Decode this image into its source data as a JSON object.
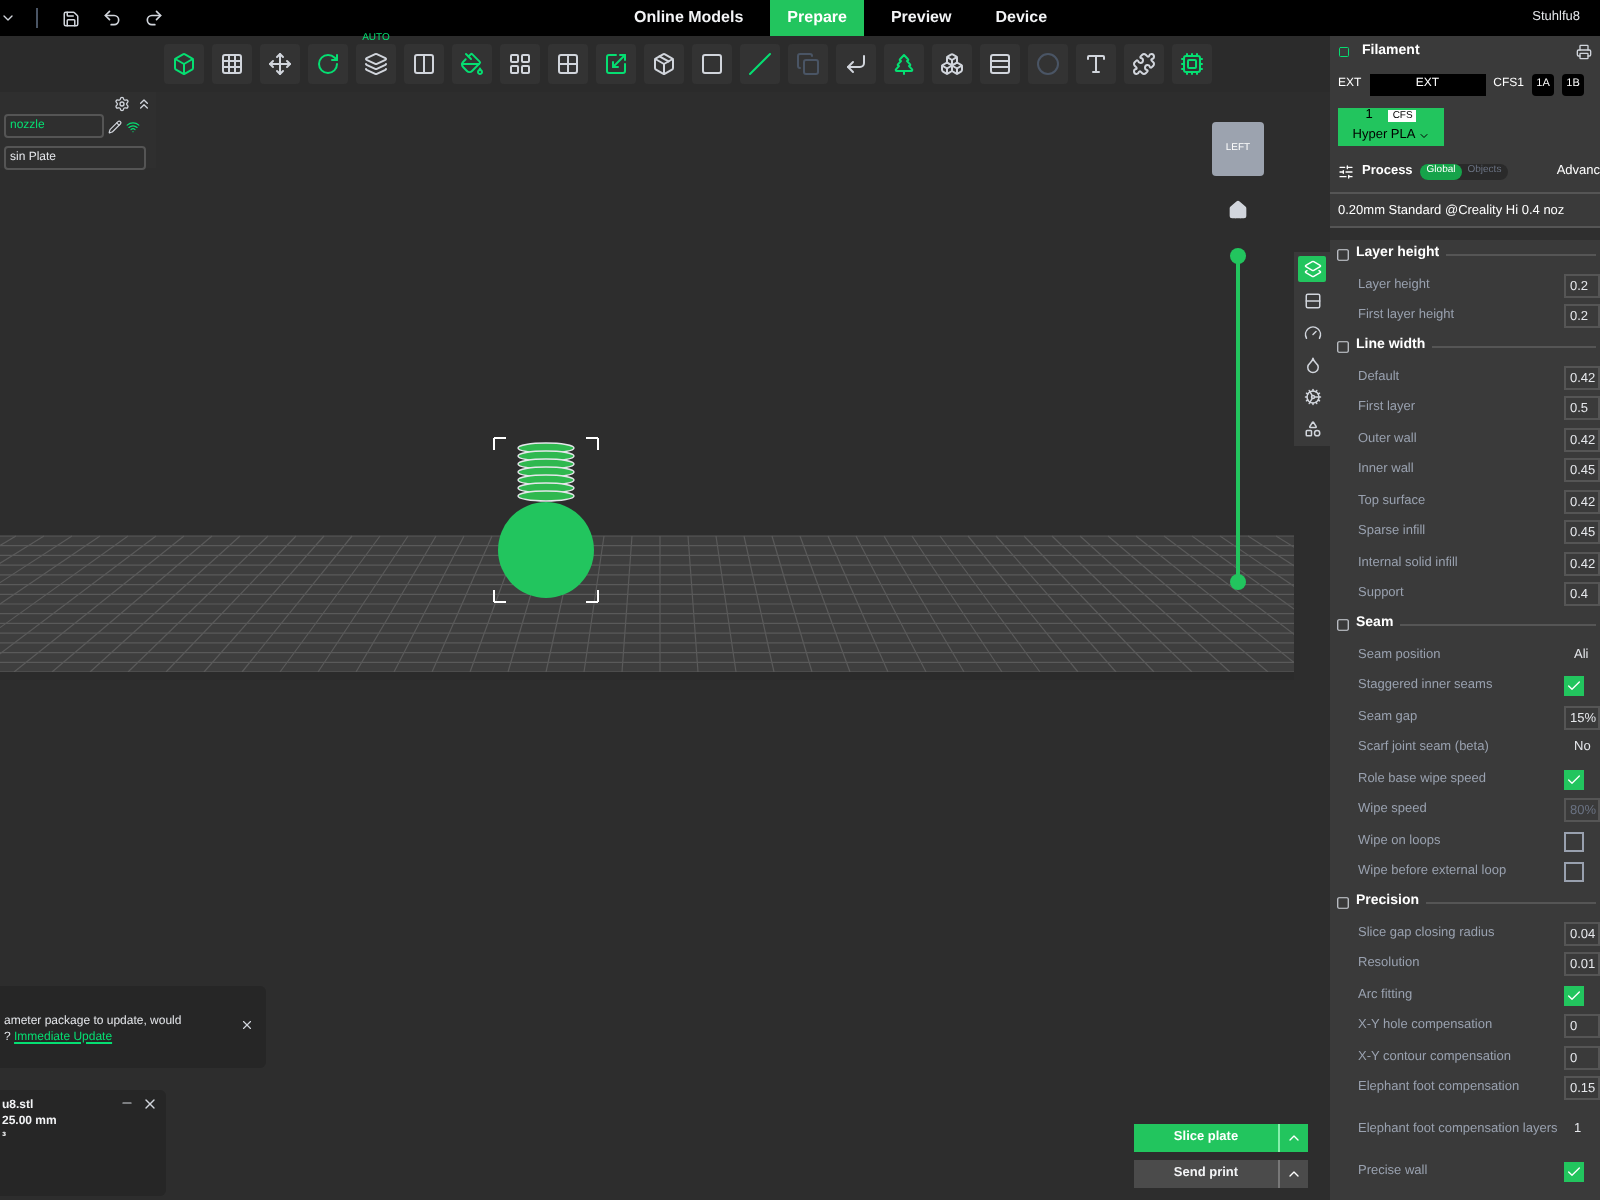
{
  "top_bar": {
    "tabs": [
      {
        "label": "Online Models",
        "selected": false
      },
      {
        "label": "Prepare",
        "selected": true
      },
      {
        "label": "Preview",
        "selected": false
      },
      {
        "label": "Device",
        "selected": false
      }
    ],
    "user": "Stuhlfu8"
  },
  "toolbar": [
    {
      "disabled": false
    },
    {
      "disabled": false
    },
    {
      "disabled": false
    },
    {
      "disabled": false
    },
    {
      "disabled": false,
      "badge": "AUTO"
    },
    {
      "disabled": false
    },
    {
      "disabled": false
    },
    {
      "disabled": false
    },
    {
      "disabled": false
    },
    {
      "disabled": false
    },
    {
      "disabled": false
    },
    {
      "disabled": false
    },
    {
      "disabled": false
    },
    {
      "disabled": true
    },
    {
      "disabled": false
    },
    {
      "disabled": false
    },
    {
      "disabled": false
    },
    {
      "disabled": false
    },
    {
      "disabled": true
    },
    {
      "disabled": false
    },
    {
      "disabled": false
    },
    {
      "disabled": false
    }
  ],
  "left_panel": {
    "printer": "nozzle",
    "plate": "sin Plate"
  },
  "view_cube": {
    "label": "LEFT"
  },
  "notification": {
    "text": "ameter package to update, would",
    "link_prefix": "?",
    "link": "Immediate Update"
  },
  "object_info": {
    "name": "u8.stl",
    "size": "25.00 mm",
    "volume": "³"
  },
  "actions": {
    "slice": "Slice plate",
    "send": "Send print"
  },
  "filament": {
    "title": "Filament",
    "ext_label": "EXT",
    "ext_value": "EXT",
    "cfs_label": "CFS1",
    "slots": [
      "1A",
      "1B"
    ],
    "card": {
      "number": "1",
      "tag": "CFS",
      "name": "Hyper PLA",
      "color": "#22c55e"
    }
  },
  "process": {
    "title": "Process",
    "scopes": [
      {
        "label": "Global",
        "selected": true
      },
      {
        "label": "Objects",
        "selected": false
      }
    ],
    "advanced": "Advanc",
    "preset": "0.20mm Standard @Creality Hi 0.4 noz"
  },
  "side_tabs": [
    {
      "selected": true
    },
    {
      "selected": false
    },
    {
      "selected": false
    },
    {
      "selected": false
    },
    {
      "selected": false
    },
    {
      "selected": false
    }
  ],
  "settings": [
    {
      "title": "Layer height",
      "rows": [
        {
          "kind": "value",
          "label": "Layer height",
          "value": "0.2"
        },
        {
          "kind": "value",
          "label": "First layer height",
          "value": "0.2"
        }
      ]
    },
    {
      "title": "Line width",
      "rows": [
        {
          "kind": "value",
          "label": "Default",
          "value": "0.42"
        },
        {
          "kind": "value",
          "label": "First layer",
          "value": "0.5"
        },
        {
          "kind": "value",
          "label": "Outer wall",
          "value": "0.42"
        },
        {
          "kind": "value",
          "label": "Inner wall",
          "value": "0.45"
        },
        {
          "kind": "value",
          "label": "Top surface",
          "value": "0.42"
        },
        {
          "kind": "value",
          "label": "Sparse infill",
          "value": "0.45"
        },
        {
          "kind": "value",
          "label": "Internal solid infill",
          "value": "0.42"
        },
        {
          "kind": "value",
          "label": "Support",
          "value": "0.4"
        }
      ]
    },
    {
      "title": "Seam",
      "rows": [
        {
          "kind": "select",
          "label": "Seam position",
          "value": "Ali"
        },
        {
          "kind": "check",
          "label": "Staggered inner seams",
          "checked": true
        },
        {
          "kind": "value",
          "label": "Seam gap",
          "value": "15%"
        },
        {
          "kind": "select",
          "label": "Scarf joint seam (beta)",
          "value": "No"
        },
        {
          "kind": "check",
          "label": "Role base wipe speed",
          "checked": true
        },
        {
          "kind": "value",
          "label": "Wipe speed",
          "value": "80%",
          "disabled": true
        },
        {
          "kind": "check",
          "label": "Wipe on loops",
          "checked": false
        },
        {
          "kind": "check",
          "label": "Wipe before external loop",
          "checked": false
        }
      ]
    },
    {
      "title": "Precision",
      "rows": [
        {
          "kind": "value",
          "label": "Slice gap closing radius",
          "value": "0.04"
        },
        {
          "kind": "value",
          "label": "Resolution",
          "value": "0.01"
        },
        {
          "kind": "check",
          "label": "Arc fitting",
          "checked": true
        },
        {
          "kind": "value",
          "label": "X-Y hole compensation",
          "value": "0"
        },
        {
          "kind": "value",
          "label": "X-Y contour compensation",
          "value": "0"
        },
        {
          "kind": "value",
          "label": "Elephant foot compensation",
          "value": "0.15"
        },
        {
          "kind": "spin",
          "label": "Elephant foot compensation layers",
          "value": "1"
        },
        {
          "kind": "check",
          "label": "Precise wall",
          "checked": true
        }
      ]
    }
  ]
}
